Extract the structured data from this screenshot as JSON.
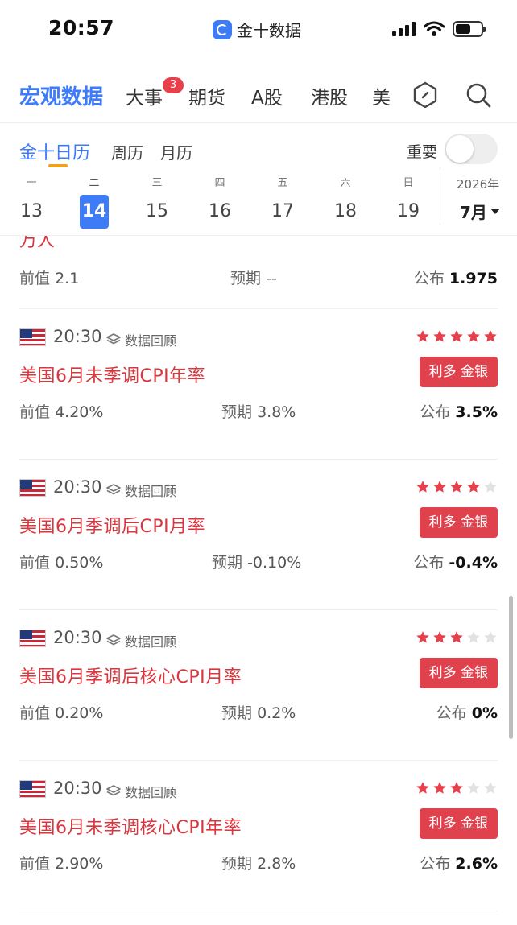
{
  "status": {
    "time": "20:57",
    "app_name": "金十数据"
  },
  "top_tabs": [
    {
      "label": "宏观数据",
      "active": true
    },
    {
      "label": "大事",
      "badge": "3"
    },
    {
      "label": "期货"
    },
    {
      "label": "A股"
    },
    {
      "label": "港股"
    },
    {
      "label": "美"
    }
  ],
  "sub_tabs": [
    {
      "label": "金十日历",
      "active": true
    },
    {
      "label": "周历"
    },
    {
      "label": "月历"
    }
  ],
  "important_toggle": {
    "label": "重要",
    "on": false
  },
  "week": {
    "days": [
      {
        "name": "一",
        "num": "13"
      },
      {
        "name": "二",
        "num": "14",
        "active": true
      },
      {
        "name": "三",
        "num": "15"
      },
      {
        "name": "四",
        "num": "16"
      },
      {
        "name": "五",
        "num": "17"
      },
      {
        "name": "六",
        "num": "18"
      },
      {
        "name": "日",
        "num": "19"
      }
    ],
    "year": "2026年",
    "month": "7月"
  },
  "labels": {
    "prev": "前值",
    "expected": "预期",
    "published": "公布",
    "review": "数据回顾"
  },
  "first_item": {
    "title_fragment": "万人",
    "prev": "2.1",
    "expected": "--",
    "published": "1.975"
  },
  "events": [
    {
      "time": "20:30",
      "stars": 5,
      "title": "美国6月未季调CPI年率",
      "impact": "利多 金银",
      "prev": "4.20%",
      "expected": "3.8%",
      "published": "3.5%",
      "accent": "#d9363e"
    },
    {
      "time": "20:30",
      "stars": 4,
      "title": "美国6月季调后CPI月率",
      "impact": "利多 金银",
      "prev": "0.50%",
      "expected": "-0.10%",
      "published": "-0.4%",
      "accent": "#d9363e"
    },
    {
      "time": "20:30",
      "stars": 3,
      "title": "美国6月季调后核心CPI月率",
      "impact": "利多 金银",
      "prev": "0.20%",
      "expected": "0.2%",
      "published": "0%",
      "accent": "#d9363e"
    },
    {
      "time": "20:30",
      "stars": 3,
      "title": "美国6月未季调核心CPI年率",
      "impact": "利多 金银",
      "prev": "2.90%",
      "expected": "2.8%",
      "published": "2.6%",
      "accent": "#d9363e"
    }
  ],
  "colors": {
    "brand": "#3d7bf7",
    "alert": "#e0424d",
    "star_on": "#e8404b",
    "star_off": "#e2e2e2"
  }
}
